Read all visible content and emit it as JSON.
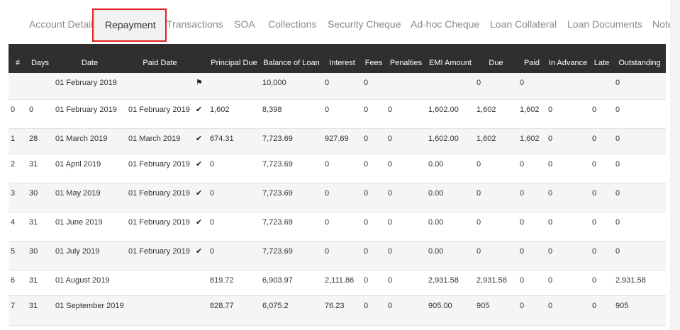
{
  "tabs": [
    {
      "label": "Account Detail",
      "active": false
    },
    {
      "label": "Repayment",
      "active": true
    },
    {
      "label": "Transactions",
      "active": false
    },
    {
      "label": "SOA",
      "active": false
    },
    {
      "label": "Collections",
      "active": false
    },
    {
      "label": "Security Cheque",
      "active": false
    },
    {
      "label": "Ad-hoc Cheque",
      "active": false
    },
    {
      "label": "Loan Collateral",
      "active": false
    },
    {
      "label": "Loan Documents",
      "active": false
    },
    {
      "label": "Note",
      "active": false
    }
  ],
  "highlight_color": "#e02020",
  "table": {
    "headers": [
      "#",
      "Days",
      "Date",
      "Paid Date",
      "",
      "Principal Due",
      "Balance of Loan",
      "Interest",
      "Fees",
      "Penalties",
      "EMI Amount",
      "Due",
      "Paid",
      "In Advance",
      "Late",
      "Outstanding"
    ],
    "header_bg": "#2f2f2f",
    "rows": [
      {
        "n": "",
        "days": "",
        "date": "01 February 2019",
        "paid_date": "",
        "status": "flag-icon",
        "principal": "",
        "balance": "10,000",
        "interest": "0",
        "fees": "0",
        "penalties": "",
        "emi": "",
        "due": "0",
        "paid": "0",
        "advance": "",
        "late": "",
        "outstanding": "0"
      },
      {
        "n": "0",
        "days": "0",
        "date": "01 February 2019",
        "paid_date": "01 February 2019",
        "status": "check-icon",
        "principal": "1,602",
        "balance": "8,398",
        "interest": "0",
        "fees": "0",
        "penalties": "0",
        "emi": "1,602.00",
        "due": "1,602",
        "paid": "1,602",
        "advance": "0",
        "late": "0",
        "outstanding": "0"
      },
      {
        "n": "1",
        "days": "28",
        "date": "01 March 2019",
        "paid_date": "01 March 2019",
        "status": "check-icon",
        "principal": "674.31",
        "balance": "7,723.69",
        "interest": "927.69",
        "fees": "0",
        "penalties": "0",
        "emi": "1,602.00",
        "due": "1,602",
        "paid": "1,602",
        "advance": "0",
        "late": "0",
        "outstanding": "0"
      },
      {
        "n": "2",
        "days": "31",
        "date": "01 April 2019",
        "paid_date": "01 February 2019",
        "status": "check-icon",
        "principal": "0",
        "balance": "7,723.69",
        "interest": "0",
        "fees": "0",
        "penalties": "0",
        "emi": "0.00",
        "due": "0",
        "paid": "0",
        "advance": "0",
        "late": "0",
        "outstanding": "0"
      },
      {
        "n": "3",
        "days": "30",
        "date": "01 May 2019",
        "paid_date": "01 February 2019",
        "status": "check-icon",
        "principal": "0",
        "balance": "7,723.69",
        "interest": "0",
        "fees": "0",
        "penalties": "0",
        "emi": "0.00",
        "due": "0",
        "paid": "0",
        "advance": "0",
        "late": "0",
        "outstanding": "0"
      },
      {
        "n": "4",
        "days": "31",
        "date": "01 June 2019",
        "paid_date": "01 February 2019",
        "status": "check-icon",
        "principal": "0",
        "balance": "7,723.69",
        "interest": "0",
        "fees": "0",
        "penalties": "0",
        "emi": "0.00",
        "due": "0",
        "paid": "0",
        "advance": "0",
        "late": "0",
        "outstanding": "0"
      },
      {
        "n": "5",
        "days": "30",
        "date": "01 July 2019",
        "paid_date": "01 February 2019",
        "status": "check-icon",
        "principal": "0",
        "balance": "7,723.69",
        "interest": "0",
        "fees": "0",
        "penalties": "0",
        "emi": "0.00",
        "due": "0",
        "paid": "0",
        "advance": "0",
        "late": "0",
        "outstanding": "0"
      },
      {
        "n": "6",
        "days": "31",
        "date": "01 August 2019",
        "paid_date": "",
        "status": "",
        "principal": "819.72",
        "balance": "6,903.97",
        "interest": "2,111.86",
        "fees": "0",
        "penalties": "0",
        "emi": "2,931.58",
        "due": "2,931.58",
        "paid": "0",
        "advance": "0",
        "late": "0",
        "outstanding": "2,931.58"
      },
      {
        "n": "7",
        "days": "31",
        "date": "01 September 2019",
        "paid_date": "",
        "status": "",
        "principal": "828.77",
        "balance": "6,075.2",
        "interest": "76.23",
        "fees": "0",
        "penalties": "0",
        "emi": "905.00",
        "due": "905",
        "paid": "0",
        "advance": "0",
        "late": "0",
        "outstanding": "905"
      }
    ]
  }
}
